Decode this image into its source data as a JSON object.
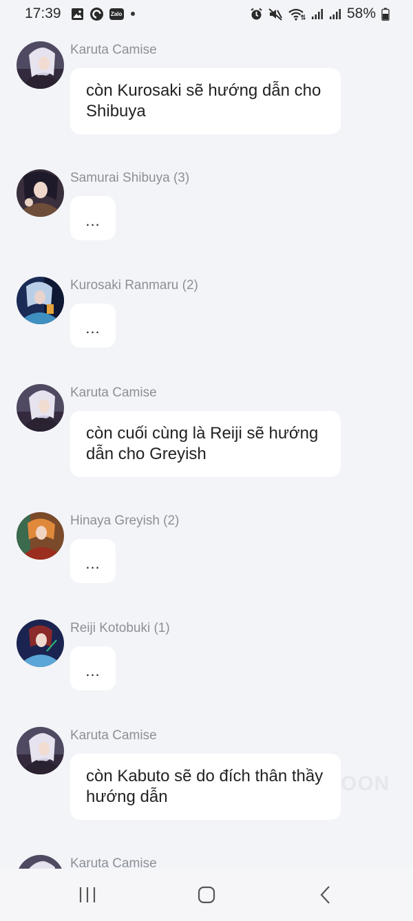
{
  "status_bar": {
    "time": "17:39",
    "battery": "58%",
    "zalo_label": "Zalo",
    "left_icons": [
      "gallery-icon",
      "messenger-icon",
      "zalo-icon",
      "notification-dot-icon"
    ],
    "right_icons": [
      "alarm-icon",
      "mute-icon",
      "wifi-icon",
      "signal-icon",
      "signal-icon",
      "battery-icon"
    ]
  },
  "messages": [
    {
      "sender": "Karuta Camise",
      "text": "còn Kurosaki sẽ hướng dẫn cho Shibuya",
      "kind": "long"
    },
    {
      "sender": "Samurai Shibuya (3)",
      "text": "...",
      "kind": "short"
    },
    {
      "sender": "Kurosaki Ranmaru (2)",
      "text": "...",
      "kind": "short"
    },
    {
      "sender": "Karuta Camise",
      "text": "còn cuối cùng là Reiji sẽ hướng dẫn cho Greyish",
      "kind": "long"
    },
    {
      "sender": "Hinaya Greyish (2)",
      "text": "...",
      "kind": "short"
    },
    {
      "sender": "Reiji Kotobuki (1)",
      "text": "...",
      "kind": "short"
    },
    {
      "sender": "Karuta Camise",
      "text": "còn Kabuto sẽ do đích thân thầy hướng dẫn",
      "kind": "long"
    },
    {
      "sender": "Karuta Camise"
    }
  ],
  "watermark": "OON",
  "nav_bar": {
    "buttons": [
      "recent-apps-button",
      "home-button",
      "back-button"
    ]
  },
  "colors": {
    "background": "#f3f4f8",
    "bubble": "#ffffff",
    "sender_text": "#8c8f96",
    "message_text": "#222222"
  }
}
